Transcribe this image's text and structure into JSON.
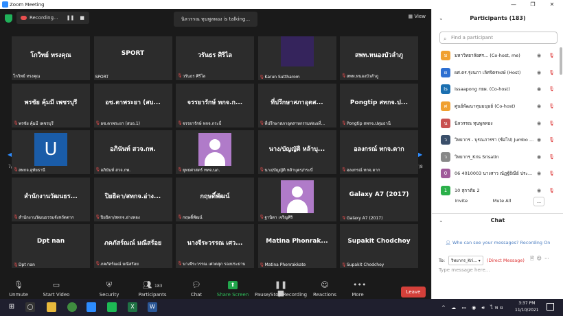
{
  "window": {
    "title": "Zoom Meeting",
    "min": "—",
    "max": "❐",
    "close": "✕"
  },
  "topbar": {
    "recording": "Recording...",
    "pause": "❚❚",
    "stop": "■",
    "talking": "นิลวรรณ ทุนพูลทอง is talking...",
    "view": "View"
  },
  "nav": {
    "left_page": "7/8",
    "right_page": "7/8"
  },
  "tiles": [
    {
      "name": "โกวิทย์ ทรงคุณ",
      "label": "โกวิทย์ ทรงคุณ",
      "muted": false,
      "kind": "text"
    },
    {
      "name": "SPORT",
      "label": "SPORT",
      "muted": false,
      "kind": "text"
    },
    {
      "name": "วรันธร ศิริไล",
      "label": "วรันธร ศิริไล",
      "muted": true,
      "kind": "text"
    },
    {
      "name": "",
      "label": "Karun Suttharom",
      "muted": true,
      "kind": "photo"
    },
    {
      "name": "สพท.หนองบัวลำภู",
      "label": "สพท.หนองบัวลำภู",
      "muted": true,
      "kind": "text"
    },
    {
      "name": "พรชัย คุ้มมี เพชรบุรี",
      "label": "พรชัย คุ้มมี เพชรบุรี",
      "muted": true,
      "kind": "text"
    },
    {
      "name": "อช.ตาพระยา (สบ...",
      "label": "อช.ตาพระยา (สบอ.1)",
      "muted": true,
      "kind": "text"
    },
    {
      "name": "จรรยารักษ์ ทกจ.ก...",
      "label": "จรรยารักษ์ ทกจ.กระบี่",
      "muted": true,
      "kind": "text"
    },
    {
      "name": "ที่ปรึกษาสภาอุตส...",
      "label": "ที่ปรึกษาสภาอุตสาหกรรมท่องเที่...",
      "muted": true,
      "kind": "text"
    },
    {
      "name": "Pongtip สทกจ.ป...",
      "label": "Pongtip สทกจ.ปทุมธานี",
      "muted": true,
      "kind": "text"
    },
    {
      "name": "",
      "label": "สทกจ.อุทัยธานี",
      "muted": true,
      "kind": "initial",
      "initial": "U"
    },
    {
      "name": "อภินันท์ สวจ.กพ.",
      "label": "อภินันท์ สวจ.กพ.",
      "muted": true,
      "kind": "text"
    },
    {
      "name": "",
      "label": "ยุทธศาสตร์ ททจ.นภ.",
      "muted": true,
      "kind": "avatar"
    },
    {
      "name": "นาง/บัญญัติ หล้าบุ...",
      "label": "นาง/บัญญัติ หล้าบุตร/กระบี่",
      "muted": true,
      "kind": "text"
    },
    {
      "name": "อลงกรณ์ ทกจ.ตาก",
      "label": "อลงกรณ์ ทกจ.ตาก",
      "muted": true,
      "kind": "text"
    },
    {
      "name": "สำนักงานวัฒนธร...",
      "label": "สำนักงานวัฒนธรรมจังหวัดตาก",
      "muted": true,
      "kind": "text"
    },
    {
      "name": "ปิยธิดา/สทกจ.อ่าง...",
      "label": "ปิยธิดา/สทกจ.อ่างทอง",
      "muted": true,
      "kind": "text"
    },
    {
      "name": "กฤษดิ์พัฒน์",
      "label": "กฤษดิ์พัฒน์",
      "muted": true,
      "kind": "text"
    },
    {
      "name": "",
      "label": "ฐานิตา เจริญศิริ",
      "muted": true,
      "kind": "avatar"
    },
    {
      "name": "Galaxy A7 (2017)",
      "label": "Galaxy A7 (2017)",
      "muted": true,
      "kind": "text"
    },
    {
      "name": "Dpt nan",
      "label": "Dpt nan",
      "muted": true,
      "kind": "text"
    },
    {
      "name": "ภคภัสร์ณณ์ มณีสร้อย",
      "label": "ภคภัสร์ณณ์ มณีสร้อย",
      "muted": true,
      "kind": "text"
    },
    {
      "name": "นางจีระวรรณ เศว...",
      "label": "นางจีระวรรณ เศวตสุภ รองประธาน",
      "muted": true,
      "kind": "text"
    },
    {
      "name": "Matina Phonrak...",
      "label": "Matina Phonrakkate",
      "muted": true,
      "kind": "text"
    },
    {
      "name": "Supakit Chodchoy",
      "label": "Supakit Chodchoy",
      "muted": true,
      "kind": "text"
    }
  ],
  "toolbar": {
    "unmute": "Unmute",
    "start_video": "Start Video",
    "security": "Security",
    "participants": "Participants",
    "participants_count": "183",
    "chat": "Chat",
    "share": "Share Screen",
    "record": "Pause/Stop Recording",
    "reactions": "Reactions",
    "more": "More",
    "leave": "Leave"
  },
  "participants_panel": {
    "title": "Participants (183)",
    "search_placeholder": "Find a participant",
    "rows": [
      {
        "name": "มหาวิทยาลัยศร... (Co-host, me)",
        "avatar": "ม",
        "color": "#f0a030"
      },
      {
        "name": "ผศ.ดร.รุ่งนภา เลิศจิตรพงษ์ (Host)",
        "avatar": "ผ",
        "color": "#2d6fd1"
      },
      {
        "name": "Issaapong กยผ. (Co-host)",
        "avatar": "Is",
        "color": "#1a6fb0"
      },
      {
        "name": "ศูนย์พัฒนาทุนมนุษย์ (Co-host)",
        "avatar": "ศ",
        "color": "#f0a030"
      },
      {
        "name": "นิลวรรณ ทุนพูลทอง",
        "avatar": "น",
        "color": "#c85050"
      },
      {
        "name": "วิทยากร - บุรณภารรา (ซ้อไป) Jumbo ...",
        "avatar": "ว",
        "color": "#3a4f6a"
      },
      {
        "name": "วิทยากร_Kris Srisatin",
        "avatar": "ว",
        "color": "#888888"
      },
      {
        "name": "06 4010003 นางสาว ณัฏฐ์ธิณีย์ ประ...",
        "avatar": "0",
        "color": "#a05a9a"
      },
      {
        "name": "10 สุกาต้ม 2",
        "avatar": "1",
        "color": "#2bb04a"
      }
    ],
    "invite": "Invite",
    "mute_all": "Mute All",
    "more": "..."
  },
  "chat_panel": {
    "title": "Chat",
    "who_can_see": "Who can see your messages? Recording On",
    "to_label": "To:",
    "to_value": "วิทยากร_Kri... ▾",
    "direct": "(Direct Message)",
    "placeholder": "Type message here..."
  },
  "taskbar": {
    "time": "3:37 PM",
    "date": "11/10/2021",
    "lang": "ไทย"
  }
}
